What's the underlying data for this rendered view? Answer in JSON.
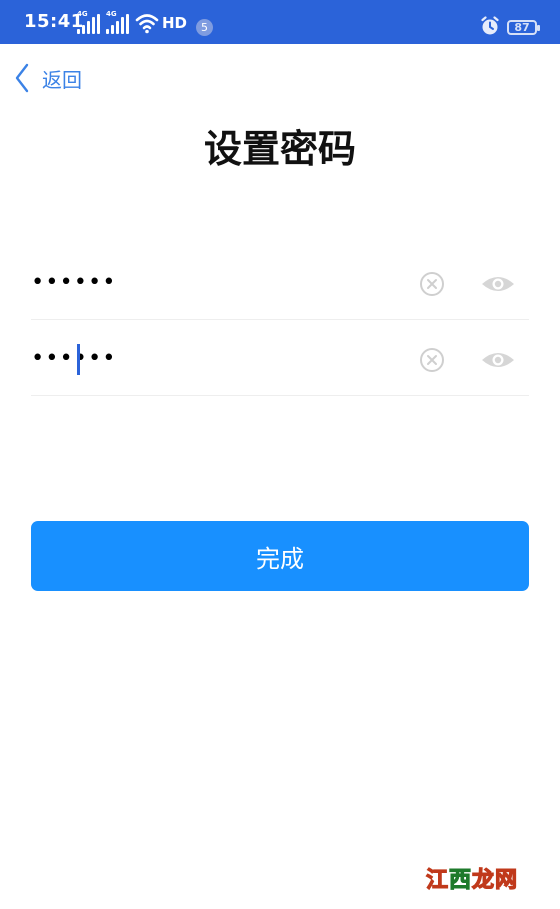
{
  "status_bar": {
    "time": "15:41",
    "signal_1_tag": "4G",
    "signal_2_tag": "4G",
    "hd_label": "HD",
    "notification_count": "5",
    "battery_level": "87",
    "background_color": "#2b63d9"
  },
  "nav": {
    "back_label": "返回",
    "back_icon": "chevron-left-icon"
  },
  "page": {
    "title": "设置密码"
  },
  "fields": [
    {
      "value": "••••••",
      "clear_icon": "clear-icon",
      "visibility_icon": "eye-icon",
      "focused": false
    },
    {
      "value": "••••••",
      "clear_icon": "clear-icon",
      "visibility_icon": "eye-icon",
      "focused": true
    }
  ],
  "actions": {
    "done_label": "完成",
    "done_color": "#1890ff"
  },
  "watermark": {
    "text_part1": "江",
    "text_part2": "西",
    "text_part3": "龙网"
  }
}
